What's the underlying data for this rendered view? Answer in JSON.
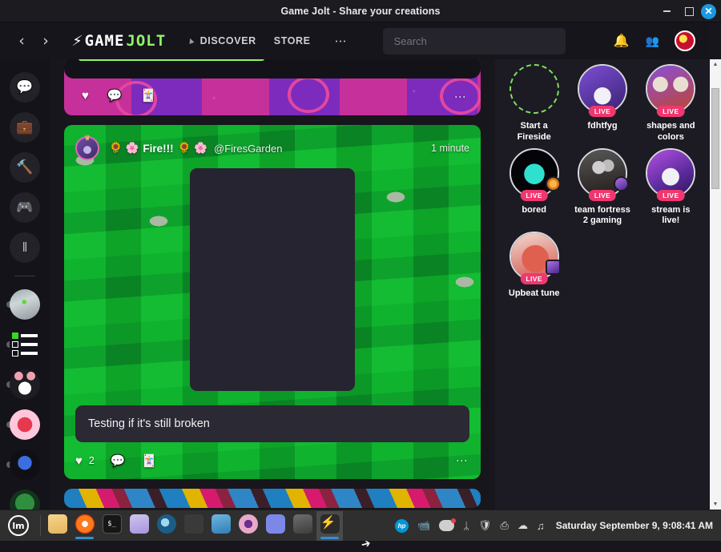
{
  "window": {
    "title": "Game Jolt - Share your creations",
    "controls": {
      "minimize": "–",
      "maximize": "□",
      "close": "✕"
    }
  },
  "header": {
    "back_icon": "‹",
    "forward_icon": "›",
    "logo": {
      "bolt": "⚡",
      "primary": "GAME",
      "accent": "JOLT"
    },
    "nav": [
      {
        "label": "DISCOVER",
        "icon": "discover-icon"
      },
      {
        "label": "STORE",
        "icon": ""
      }
    ],
    "more_icon": "⋮",
    "search": {
      "value": "",
      "placeholder": "Search"
    },
    "notifications_icon": "🔔",
    "friends_icon": "friends-icon",
    "avatar": "user-avatar"
  },
  "rail": {
    "buttons": [
      {
        "name": "chat-icon",
        "glyph": "💬"
      },
      {
        "name": "shop-icon",
        "glyph": "💼"
      },
      {
        "name": "quests-icon",
        "glyph": "🔨"
      },
      {
        "name": "library-icon",
        "glyph": "🎮"
      },
      {
        "name": "charts-icon",
        "glyph": "‖"
      }
    ],
    "avatars": [
      {
        "name": "rail-avatar-photo"
      },
      {
        "name": "rail-avatar-checklist"
      },
      {
        "name": "rail-avatar-cat"
      },
      {
        "name": "rail-avatar-star"
      },
      {
        "name": "rail-avatar-blue-character"
      },
      {
        "name": "rail-avatar-green"
      }
    ]
  },
  "feed": {
    "top_post": {
      "actions": {
        "like_icon": "♥",
        "comment_icon": "💬",
        "share_icon": "🃏"
      },
      "kebab": "⋮"
    },
    "post": {
      "author_name": "Fire!!!",
      "author_handle": "@FiresGarden",
      "emoji_before": "🌻 🌸",
      "emoji_after": "🌻 🌸",
      "timestamp": "1 minute",
      "caption": "Testing if it's still broken",
      "media": "empty-video-placeholder",
      "actions": {
        "like_icon": "♥",
        "like_count": "2",
        "comment_icon": "💬",
        "share_icon": "🃏",
        "kebab": "⋮"
      }
    }
  },
  "right_sidebar": {
    "firesides": [
      {
        "label": "Start a Fireside",
        "live": false,
        "art": "dashed",
        "badge": null
      },
      {
        "label": "fdhtfyg",
        "live": true,
        "live_label": "LIVE",
        "art": "fdhtfyg",
        "badge": null
      },
      {
        "label": "shapes and colors",
        "live": true,
        "live_label": "LIVE",
        "art": "shapes",
        "badge": null
      },
      {
        "label": "bored",
        "live": true,
        "live_label": "LIVE",
        "art": "bored",
        "badge": "orange"
      },
      {
        "label": "team fortress 2 gaming",
        "live": true,
        "live_label": "LIVE",
        "art": "tf2",
        "badge": "purple"
      },
      {
        "label": "stream is live!",
        "live": true,
        "live_label": "LIVE",
        "art": "stream",
        "badge": null
      },
      {
        "label": "Upbeat tune",
        "live": true,
        "live_label": "LIVE",
        "art": "upbeat",
        "badge": "square"
      }
    ]
  },
  "scrollbar": {
    "up_arrow": "▲",
    "down_arrow": "▼"
  },
  "taskbar": {
    "menu": {
      "label": "lm",
      "name": "linux-mint-menu"
    },
    "items": [
      {
        "name": "files",
        "icon": "files-icon"
      },
      {
        "name": "firefox",
        "icon": "firefox-icon"
      },
      {
        "name": "terminal",
        "icon": "terminal-icon",
        "glyph": "$_"
      },
      {
        "name": "text-editor",
        "icon": "text-editor-icon"
      },
      {
        "name": "steam",
        "icon": "steam-icon"
      },
      {
        "name": "calculator",
        "icon": "calculator-icon"
      },
      {
        "name": "drawing",
        "icon": "drawing-icon"
      },
      {
        "name": "camera",
        "icon": "camera-icon"
      },
      {
        "name": "discord",
        "icon": "discord-icon"
      },
      {
        "name": "minecraft",
        "icon": "minecraft-icon"
      },
      {
        "name": "game-jolt",
        "icon": "game-jolt-icon",
        "active": true
      }
    ],
    "tray": [
      {
        "name": "hp-icon",
        "glyph": "hp"
      },
      {
        "name": "camera-tray-icon",
        "glyph": "📹"
      },
      {
        "name": "discord-tray-icon",
        "glyph": ""
      },
      {
        "name": "bluetooth-icon",
        "glyph": "ᛦ"
      },
      {
        "name": "shield-icon",
        "glyph": "🛡"
      },
      {
        "name": "printer-icon",
        "glyph": "⎙"
      },
      {
        "name": "wifi-icon",
        "glyph": "📶"
      },
      {
        "name": "music-icon",
        "glyph": "♫"
      }
    ],
    "clock": "Saturday September  9, 9:08:41 AM"
  },
  "colors": {
    "accent_green": "#8ff36a",
    "live_pink": "#f0376f",
    "app_bg": "#17161c",
    "panel_bg": "#1c1b23",
    "close_blue": "#1a9ae0"
  }
}
